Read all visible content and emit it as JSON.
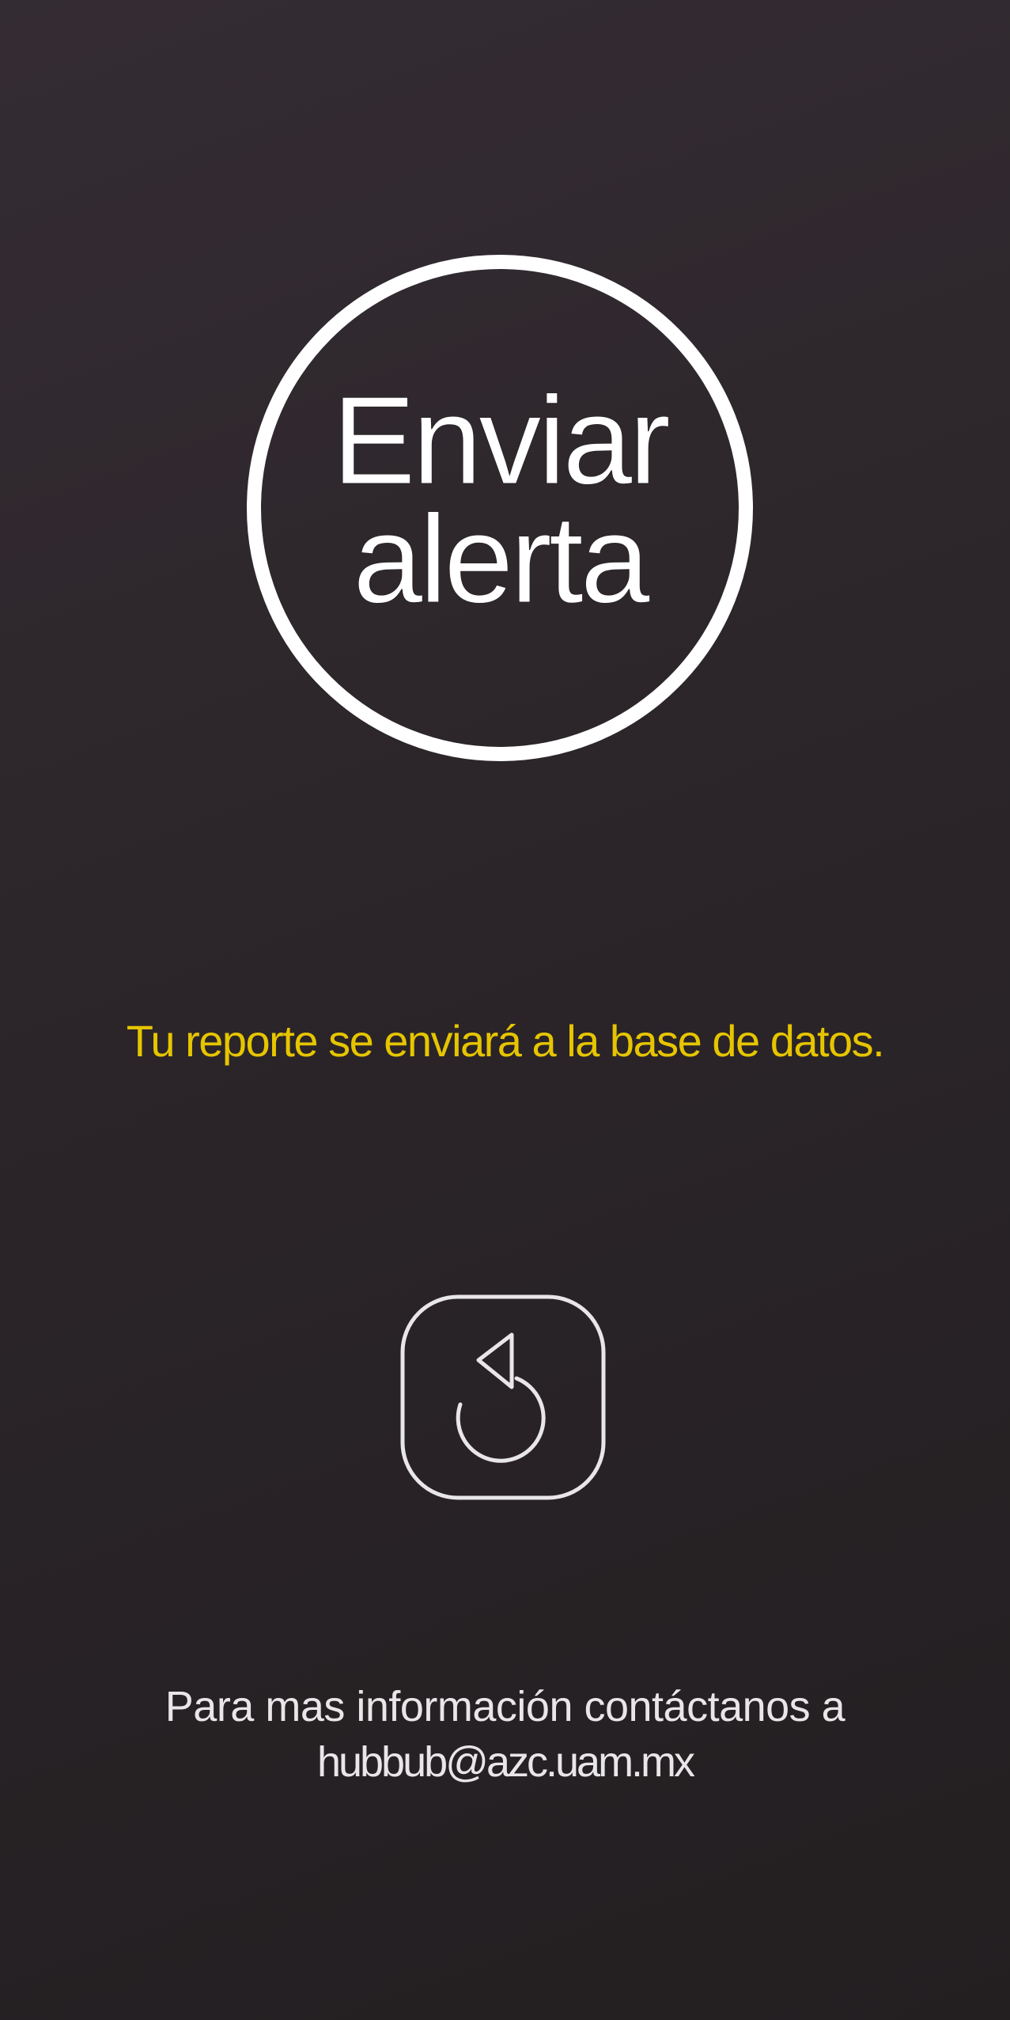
{
  "screen": {
    "background_top": "#342c33",
    "background_bottom": "#231f21"
  },
  "alert_button": {
    "label_line1": "Enviar",
    "label_line2": "alerta",
    "border_color": "#ffffff"
  },
  "info_message": {
    "text": "Tu reporte se enviará a la base de datos.",
    "color": "#e6c500"
  },
  "reset_button": {
    "icon": "undo-icon"
  },
  "contact": {
    "prefix": "Para mas información contáctanos a",
    "email": "hubbub@azc.uam.mx"
  }
}
